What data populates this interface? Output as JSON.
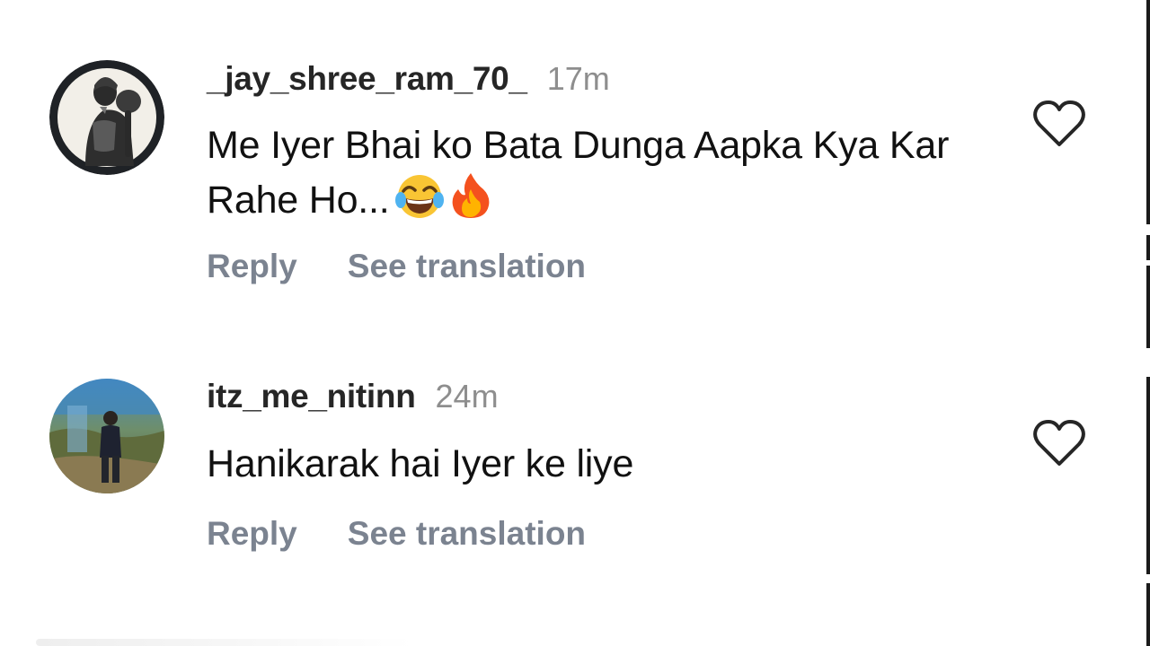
{
  "comments": [
    {
      "username": "_jay_shree_ram_70_",
      "time": "17m",
      "text": "Me Iyer Bhai ko Bata Dunga Aapka Kya Kar Rahe Ho...",
      "emojis": [
        "😂",
        "🔥"
      ],
      "avatar_icon": "hanuman-avatar",
      "reply_label": "Reply",
      "translate_label": "See translation",
      "like_icon": "heart-outline-icon"
    },
    {
      "username": "itz_me_nitinn",
      "time": "24m",
      "text": "Hanikarak hai Iyer ke liye",
      "emojis": [],
      "avatar_icon": "person-photo-avatar",
      "reply_label": "Reply",
      "translate_label": "See translation",
      "like_icon": "heart-outline-icon"
    }
  ],
  "colors": {
    "username": "#262626",
    "timestamp": "#8e8e8e",
    "action": "#7b8390",
    "text": "#111111",
    "heart_stroke": "#262626"
  }
}
